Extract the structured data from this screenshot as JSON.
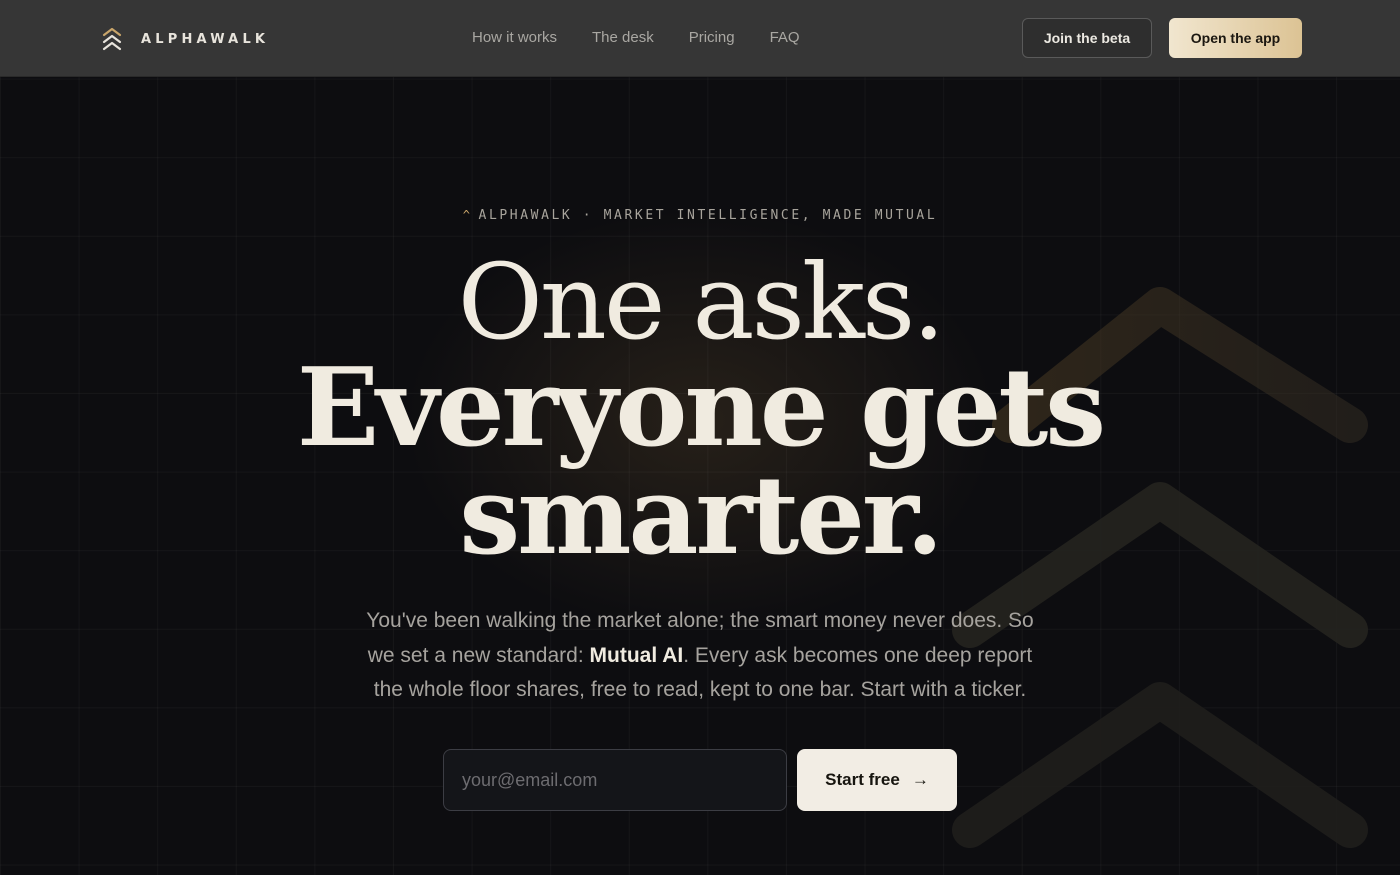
{
  "brand": {
    "name": "ALPHAWALK",
    "icon": "double-chevron-up-icon"
  },
  "nav": {
    "items": [
      {
        "label": "How it works"
      },
      {
        "label": "The desk"
      },
      {
        "label": "Pricing"
      },
      {
        "label": "FAQ"
      }
    ]
  },
  "header": {
    "join_label": "Join the beta",
    "open_label": "Open the app"
  },
  "hero": {
    "eyebrow": "ALPHAWALK · MARKET INTELLIGENCE, MADE MUTUAL",
    "line1": "One asks.",
    "line2": "Everyone gets",
    "line3": "smarter.",
    "sub_before": "You've been walking the market alone; the smart money never does. So we set a new standard: ",
    "sub_bold": "Mutual AI",
    "sub_after": ". Every ask becomes one deep report the whole floor shares, free to read, kept to one bar. Start with a ticker.",
    "email_placeholder": "your@email.com",
    "start_label": "Start free",
    "start_icon": "arrow-right-icon"
  },
  "colors": {
    "accent_gold": "#dcc394",
    "background": "#0d0d10",
    "header_bg": "#363636",
    "headline": "#f0ebe0"
  }
}
